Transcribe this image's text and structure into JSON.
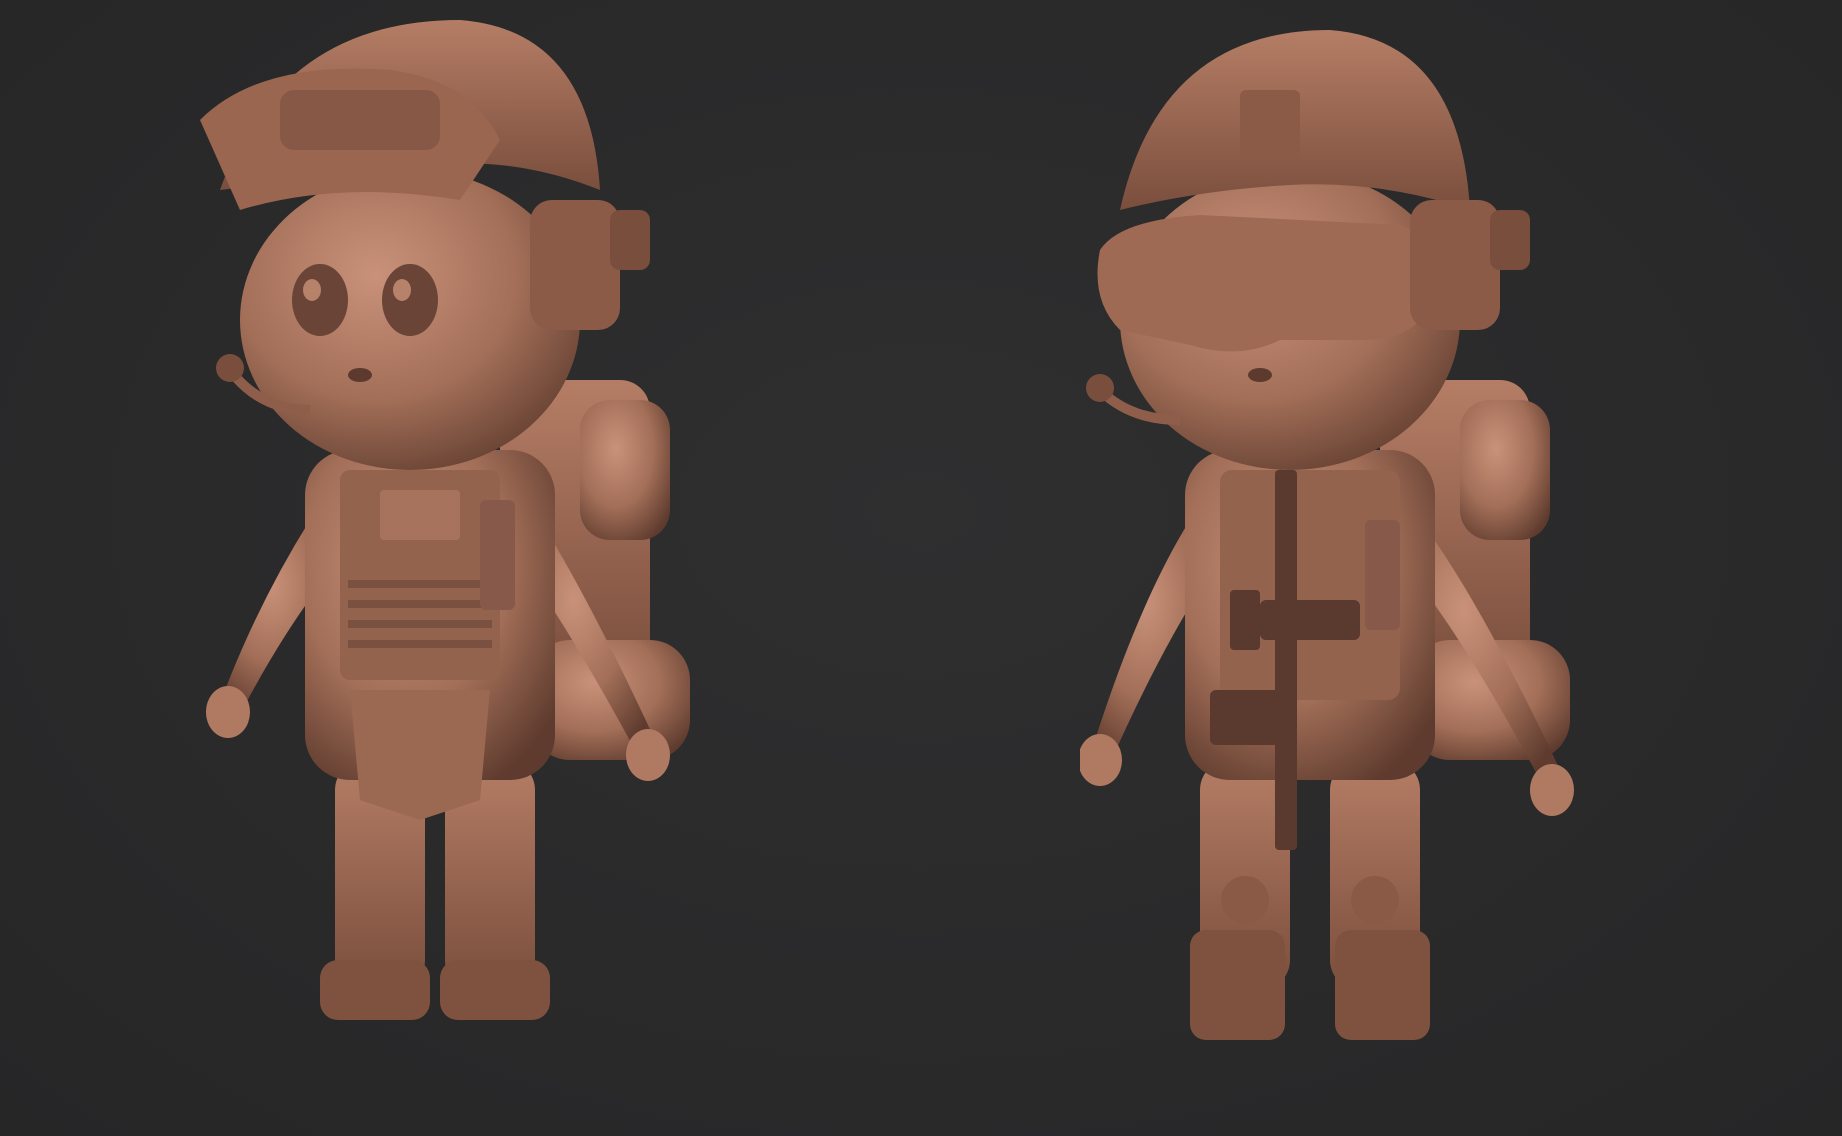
{
  "scene": {
    "background_color": "#2a2a2b",
    "clay_color": "#a36f58",
    "clay_dark": "#6e4636",
    "clay_light": "#c58d72",
    "weapon_color": "#5a3a2e"
  },
  "figures": [
    {
      "id": "left",
      "pose": "t-pose",
      "view": "three-quarter",
      "goggles": "raised-on-helmet"
    },
    {
      "id": "right",
      "pose": "t-pose",
      "view": "three-quarter",
      "goggles": "lowered-over-eyes",
      "weapon": "rifle"
    }
  ]
}
